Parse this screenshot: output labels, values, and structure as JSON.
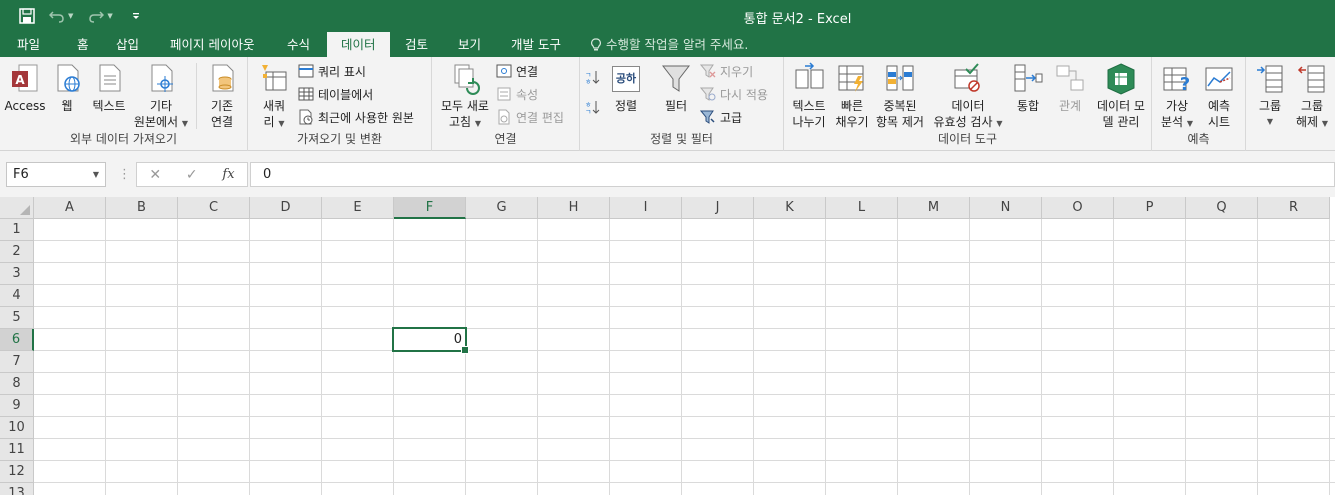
{
  "app": {
    "title": "통합 문서2 - Excel",
    "accent": "#217346"
  },
  "menu": {
    "tabs": [
      {
        "label": "파일"
      },
      {
        "label": "홈"
      },
      {
        "label": "삽입"
      },
      {
        "label": "페이지 레이아웃"
      },
      {
        "label": "수식"
      },
      {
        "label": "데이터"
      },
      {
        "label": "검토"
      },
      {
        "label": "보기"
      },
      {
        "label": "개발 도구"
      }
    ],
    "active_tab": "데이터",
    "tell_me": "수행할 작업을 알려 주세요."
  },
  "ribbon": {
    "external": {
      "label": "외부 데이터 가져오기",
      "access": "Access",
      "web": "웹",
      "text": "텍스트",
      "other_line1": "기타",
      "other_line2": "원본에서",
      "existing_line1": "기존",
      "existing_line2": "연결"
    },
    "transform": {
      "label": "가져오기 및 변환",
      "new_query_line1": "새쿼",
      "new_query_line2": "리",
      "show_queries": "쿼리 표시",
      "from_table": "테이블에서",
      "recent_sources": "최근에 사용한 원본"
    },
    "connections": {
      "label": "연결",
      "refresh_line1": "모두 새로",
      "refresh_line2": "고침",
      "connections": "연결",
      "properties": "속성",
      "edit_links": "연결 편집"
    },
    "sort_filter": {
      "label": "정렬 및 필터",
      "sort": "정렬",
      "filter": "필터",
      "clear": "지우기",
      "reapply": "다시 적용",
      "advanced": "고급",
      "sort_icon_text": "공하"
    },
    "data_tools": {
      "label": "데이터 도구",
      "text_to_columns_line1": "텍스트",
      "text_to_columns_line2": "나누기",
      "flash_fill_line1": "빠른",
      "flash_fill_line2": "채우기",
      "remove_dup_line1": "중복된",
      "remove_dup_line2": "항목 제거",
      "validation_line1": "데이터",
      "validation_line2": "유효성 검사",
      "consolidate": "통합",
      "relationships": "관계",
      "data_model_line1": "데이터 모",
      "data_model_line2": "델 관리"
    },
    "forecast": {
      "label": "예측",
      "what_if_line1": "가상",
      "what_if_line2": "분석",
      "forecast_sheet_line1": "예측",
      "forecast_sheet_line2": "시트"
    },
    "outline": {
      "group": "그룹",
      "ungroup_line1": "그룹",
      "ungroup_line2": "해제"
    }
  },
  "formula_bar": {
    "name_box": "F6",
    "formula": "0",
    "fx": "fx"
  },
  "sheet": {
    "columns": [
      "A",
      "B",
      "C",
      "D",
      "E",
      "F",
      "G",
      "H",
      "I",
      "J",
      "K",
      "L",
      "M",
      "N",
      "O",
      "P",
      "Q",
      "R"
    ],
    "rows": [
      "1",
      "2",
      "3",
      "4",
      "5",
      "6",
      "7",
      "8",
      "9",
      "10",
      "11",
      "12",
      "13"
    ],
    "selected_column": "F",
    "selected_row": "6",
    "cells": {
      "F6": "0"
    }
  }
}
